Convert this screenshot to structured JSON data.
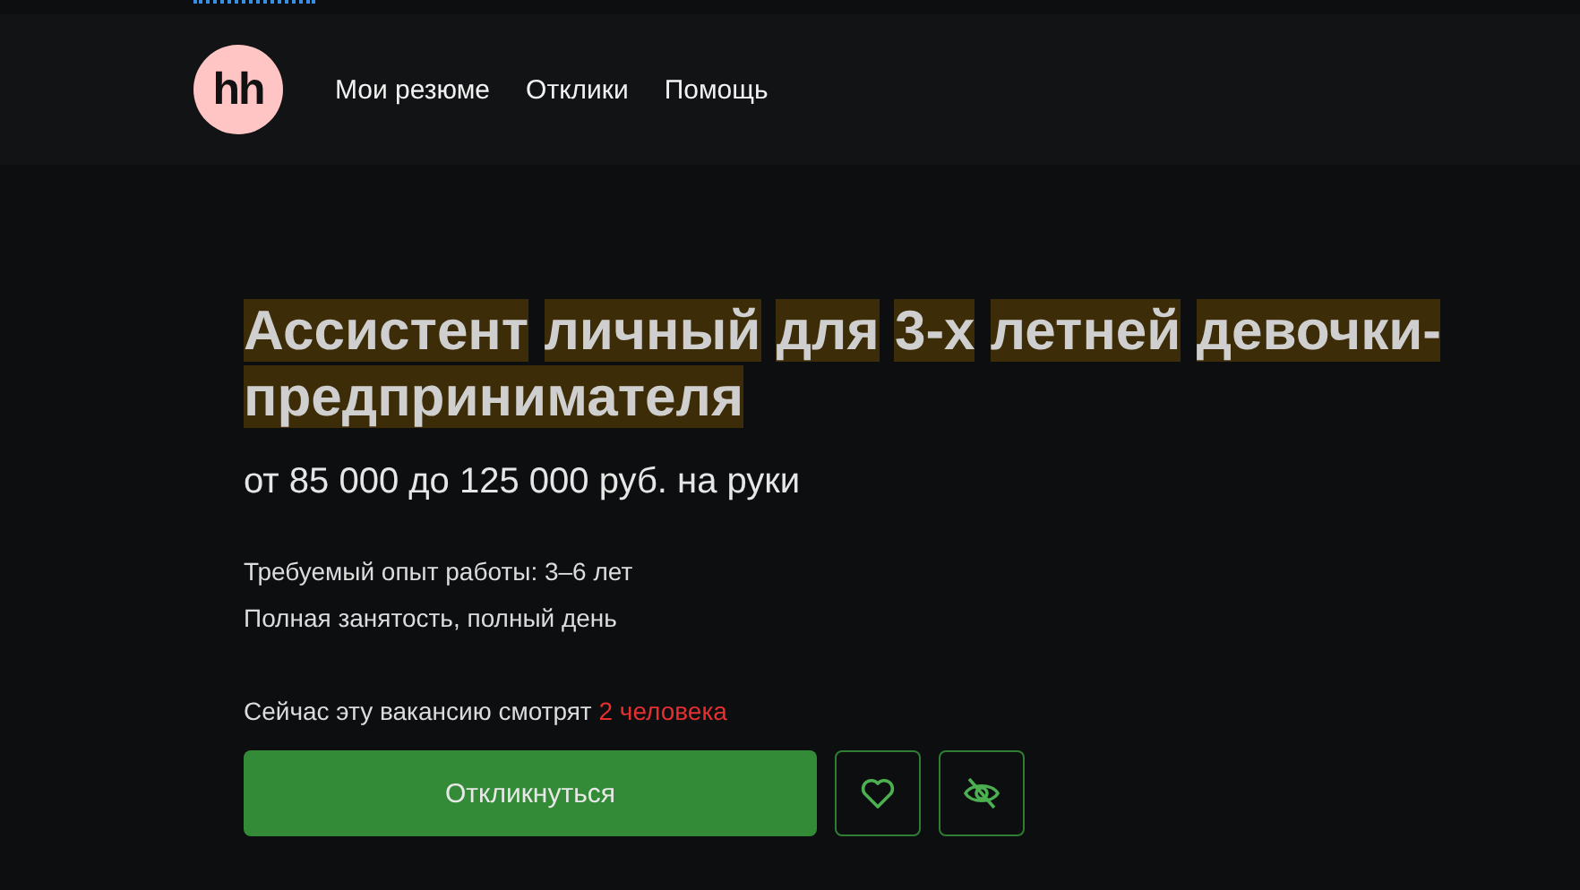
{
  "header": {
    "logo": "hh",
    "nav": [
      {
        "label": "Мои резюме"
      },
      {
        "label": "Отклики"
      },
      {
        "label": "Помощь"
      }
    ]
  },
  "vacancy": {
    "title": "Ассистент личный для 3-х летней девочки-предпринимателя",
    "title_highlighted": true,
    "salary": "от 85 000 до 125 000 руб. на руки",
    "experience": "Требуемый опыт работы: 3–6 лет",
    "employment": "Полная занятость, полный день",
    "viewers_text": "Сейчас эту вакансию смотрят",
    "viewers_count": "2 человека",
    "respond_button": "Откликнуться",
    "favorite": false,
    "hidden": false
  }
}
